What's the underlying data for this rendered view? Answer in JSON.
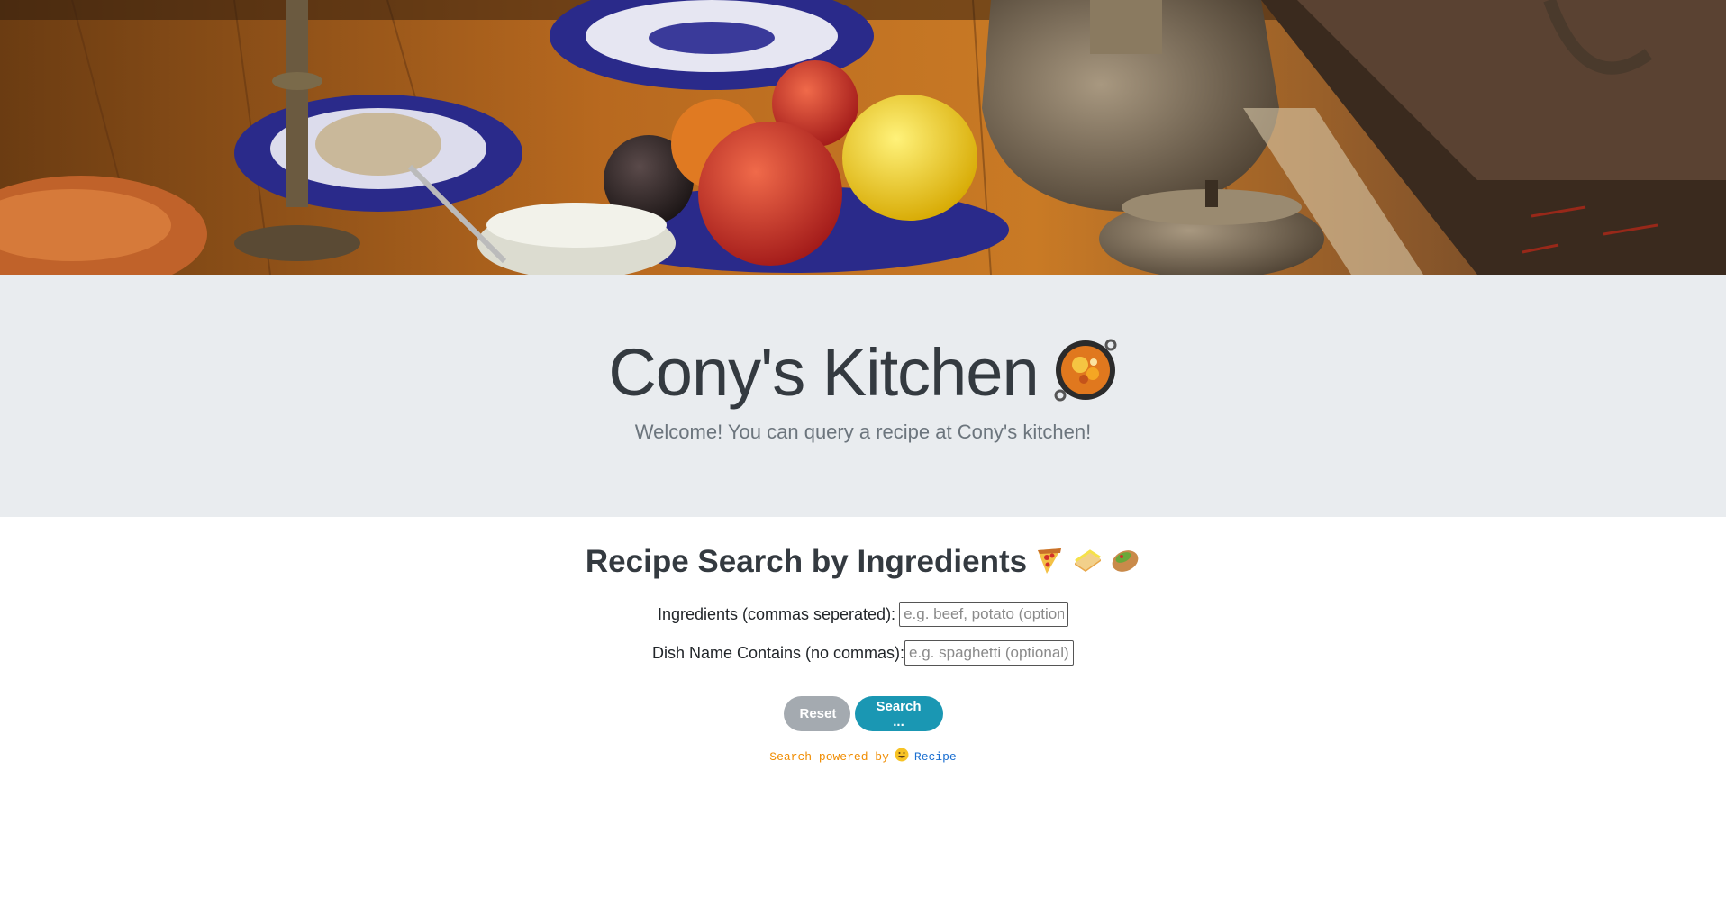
{
  "hero": {
    "image_name": "kitchen-table-still-life"
  },
  "jumbotron": {
    "title": "Cony's Kitchen",
    "title_icon": "shallow-pan-of-food-icon",
    "subtitle": "Welcome! You can query a recipe at Cony's kitchen!"
  },
  "search": {
    "heading": "Recipe Search by Ingredients",
    "heading_icons": [
      "pizza-icon",
      "sandwich-icon",
      "stuffed-flatbread-icon"
    ],
    "ingredients_label": "Ingredients (commas seperated):",
    "ingredients_placeholder": "e.g. beef, potato (optional)",
    "ingredients_value": "",
    "dish_label": "Dish Name Contains (no commas):",
    "dish_placeholder": "e.g. spaghetti (optional)",
    "dish_value": "",
    "reset_label": "Reset",
    "search_label": "Search ..."
  },
  "footer": {
    "powered_text": "Search powered by",
    "powered_icon": "grinning-face-icon",
    "powered_link": "Recipe"
  },
  "colors": {
    "jumbotron_bg": "#e9ecef",
    "reset_button": "#a4aab0",
    "search_button": "#1a97b3",
    "powered_text": "#f08c00",
    "powered_link": "#1a6fd1"
  }
}
